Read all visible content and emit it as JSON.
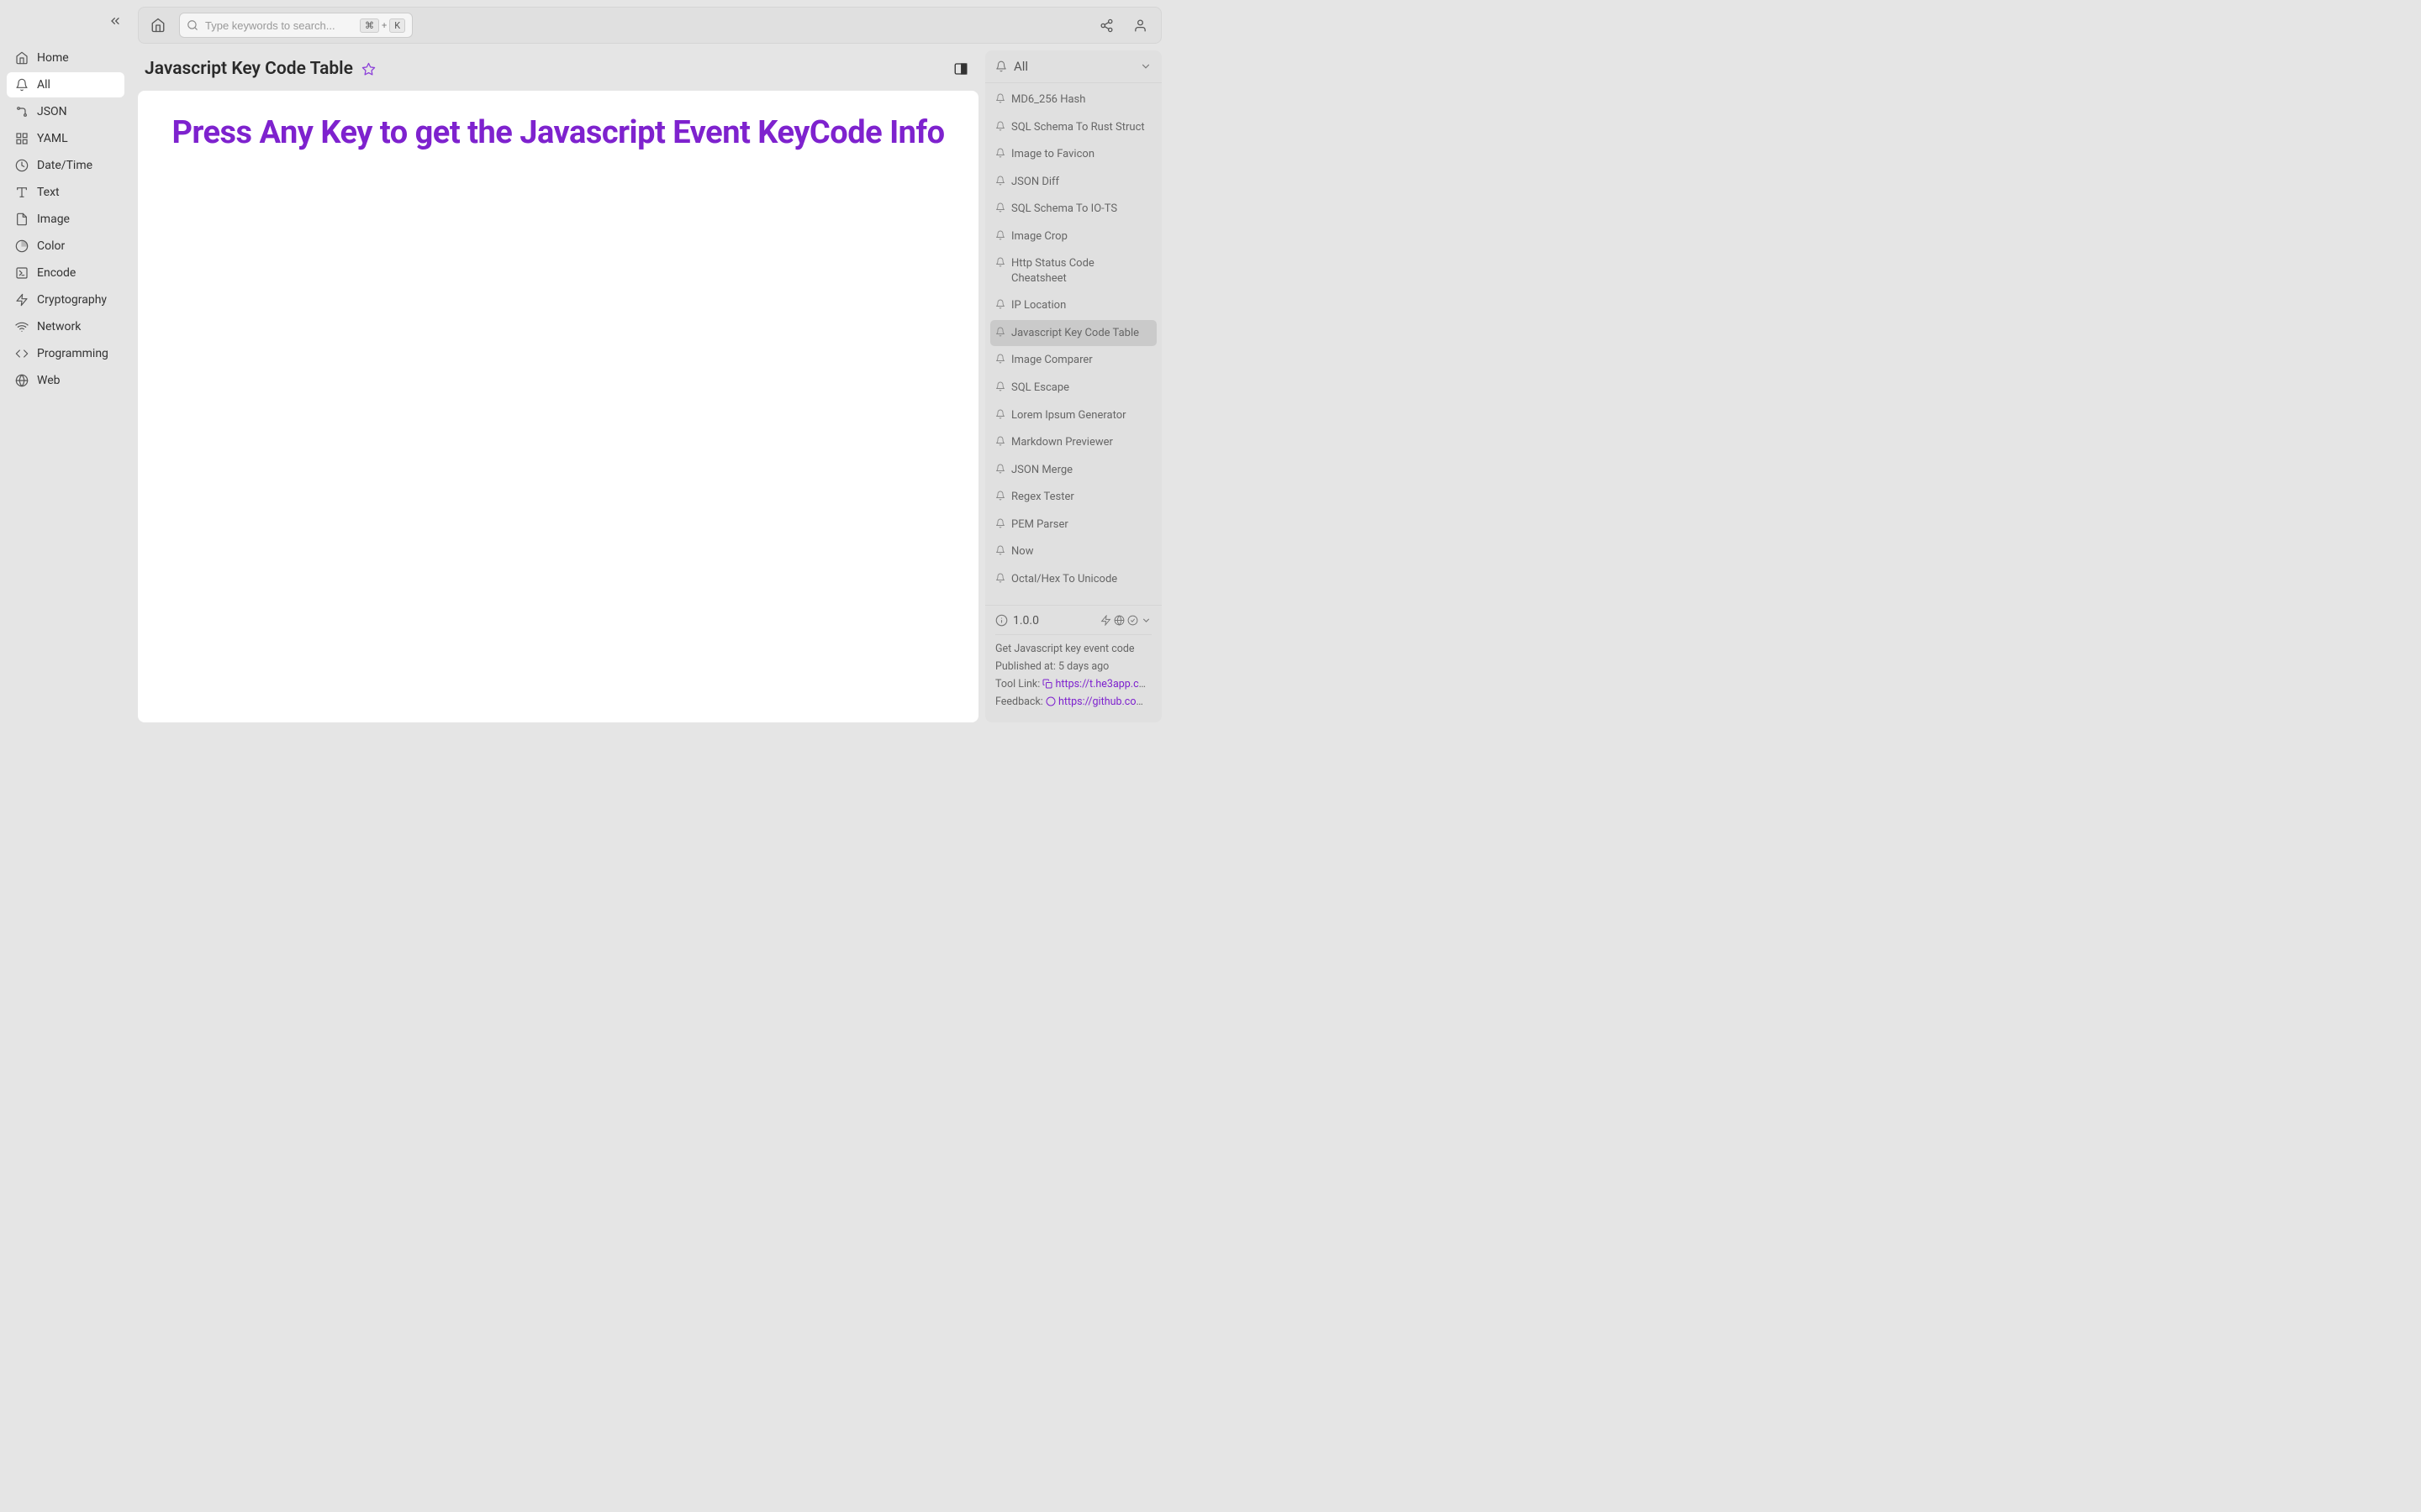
{
  "sidebar": {
    "items": [
      {
        "label": "Home",
        "icon": "home-icon"
      },
      {
        "label": "All",
        "icon": "all-icon",
        "active": true
      },
      {
        "label": "JSON",
        "icon": "json-icon"
      },
      {
        "label": "YAML",
        "icon": "yaml-icon"
      },
      {
        "label": "Date/Time",
        "icon": "datetime-icon"
      },
      {
        "label": "Text",
        "icon": "text-icon"
      },
      {
        "label": "Image",
        "icon": "image-icon"
      },
      {
        "label": "Color",
        "icon": "color-icon"
      },
      {
        "label": "Encode",
        "icon": "encode-icon"
      },
      {
        "label": "Cryptography",
        "icon": "cryptography-icon"
      },
      {
        "label": "Network",
        "icon": "network-icon"
      },
      {
        "label": "Programming",
        "icon": "programming-icon"
      },
      {
        "label": "Web",
        "icon": "web-icon"
      }
    ]
  },
  "topbar": {
    "search_placeholder": "Type keywords to search...",
    "shortcut_key1": "⌘",
    "shortcut_plus": "+",
    "shortcut_key2": "K"
  },
  "page": {
    "title": "Javascript Key Code Table",
    "body_heading": "Press Any Key to get the Javascript Event KeyCode Info"
  },
  "right_panel": {
    "filter_label": "All",
    "items": [
      {
        "label": "MD6_256 Hash"
      },
      {
        "label": "SQL Schema To Rust Struct"
      },
      {
        "label": "Image to Favicon"
      },
      {
        "label": "JSON Diff"
      },
      {
        "label": "SQL Schema To IO-TS"
      },
      {
        "label": "Image Crop"
      },
      {
        "label": "Http Status Code Cheatsheet"
      },
      {
        "label": "IP Location"
      },
      {
        "label": "Javascript Key Code Table",
        "active": true
      },
      {
        "label": "Image Comparer"
      },
      {
        "label": "SQL Escape"
      },
      {
        "label": "Lorem Ipsum Generator"
      },
      {
        "label": "Markdown Previewer"
      },
      {
        "label": "JSON Merge"
      },
      {
        "label": "Regex Tester"
      },
      {
        "label": "PEM Parser"
      },
      {
        "label": "Now"
      },
      {
        "label": "Octal/Hex To Unicode"
      }
    ],
    "footer": {
      "version": "1.0.0",
      "description": "Get Javascript key event code",
      "published_label": "Published at:",
      "published_value": "5 days ago",
      "tool_link_label": "Tool Link:",
      "tool_link_value": "https://t.he3app.co…",
      "feedback_label": "Feedback:",
      "feedback_value": "https://github.com/…"
    }
  }
}
